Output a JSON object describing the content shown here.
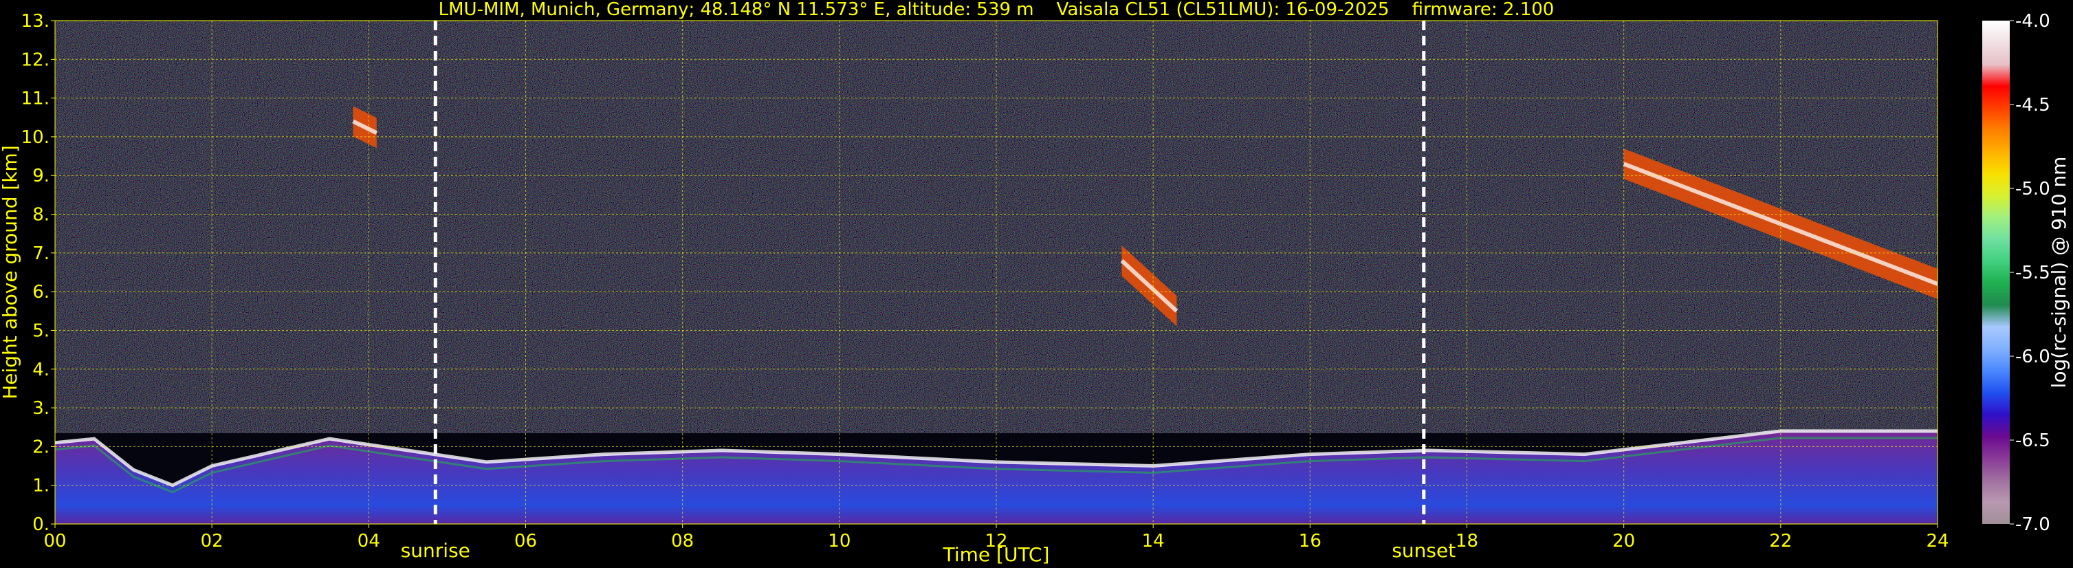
{
  "chart_data": {
    "type": "heatmap",
    "title": "LMU-MIM, Munich, Germany; 48.148° N 11.573° E, altitude: 539 m    Vaisala CL51 (CL51LMU): 16-09-2025    firmware: 2.100",
    "xlabel": "Time [UTC]",
    "ylabel": "Height above ground [km]",
    "colorbar_label": "log(rc-signal) @ 910 nm",
    "xlim": [
      0,
      24
    ],
    "ylim": [
      0,
      13
    ],
    "clim": [
      -7.0,
      -4.0
    ],
    "x_ticks": [
      "00",
      "02",
      "04",
      "06",
      "08",
      "10",
      "12",
      "14",
      "16",
      "18",
      "20",
      "22",
      "24"
    ],
    "y_ticks": [
      "0.",
      "1.",
      "2.",
      "3.",
      "4.",
      "5.",
      "6.",
      "7.",
      "8.",
      "9.",
      "10.",
      "11.",
      "12.",
      "13."
    ],
    "colorbar_ticks": [
      "-7.0",
      "-6.5",
      "-6.0",
      "-5.5",
      "-5.0",
      "-4.5",
      "-4.0"
    ],
    "grid": true,
    "markers": [
      {
        "label": "sunrise",
        "x": 4.85
      },
      {
        "label": "sunset",
        "x": 17.45
      }
    ],
    "boundary_layer_top_km": [
      {
        "x": 0,
        "y": 2.1
      },
      {
        "x": 0.5,
        "y": 2.2
      },
      {
        "x": 1.0,
        "y": 1.4
      },
      {
        "x": 1.5,
        "y": 1.0
      },
      {
        "x": 2.0,
        "y": 1.5
      },
      {
        "x": 3.5,
        "y": 2.2
      },
      {
        "x": 4.5,
        "y": 1.9
      },
      {
        "x": 5.5,
        "y": 1.6
      },
      {
        "x": 7.0,
        "y": 1.8
      },
      {
        "x": 8.5,
        "y": 1.9
      },
      {
        "x": 10.0,
        "y": 1.8
      },
      {
        "x": 12.0,
        "y": 1.6
      },
      {
        "x": 14.0,
        "y": 1.5
      },
      {
        "x": 16.0,
        "y": 1.8
      },
      {
        "x": 17.5,
        "y": 1.9
      },
      {
        "x": 19.5,
        "y": 1.8
      },
      {
        "x": 22.0,
        "y": 2.4
      },
      {
        "x": 24.0,
        "y": 2.4
      }
    ],
    "cloud_features": [
      {
        "x_start": 20.0,
        "x_end": 24.0,
        "y_start": 9.3,
        "y_end": 6.2
      },
      {
        "x_start": 13.6,
        "x_end": 14.3,
        "y_start": 6.8,
        "y_end": 5.5
      },
      {
        "x_start": 3.8,
        "x_end": 4.1,
        "y_start": 10.4,
        "y_end": 10.1
      }
    ],
    "colormap": [
      "#a09098",
      "#b898b0",
      "#a070a0",
      "#8a3a98",
      "#6a0a90",
      "#3010c8",
      "#2050f0",
      "#4a88ff",
      "#80b0ff",
      "#a8c8ff",
      "#208a50",
      "#20b050",
      "#40d080",
      "#70e0a0",
      "#a0f080",
      "#d8f030",
      "#f8e000",
      "#ffb000",
      "#ff8000",
      "#ff4000",
      "#ff0000",
      "#e8c0c8",
      "#f0e0e4",
      "#ffffff"
    ]
  }
}
